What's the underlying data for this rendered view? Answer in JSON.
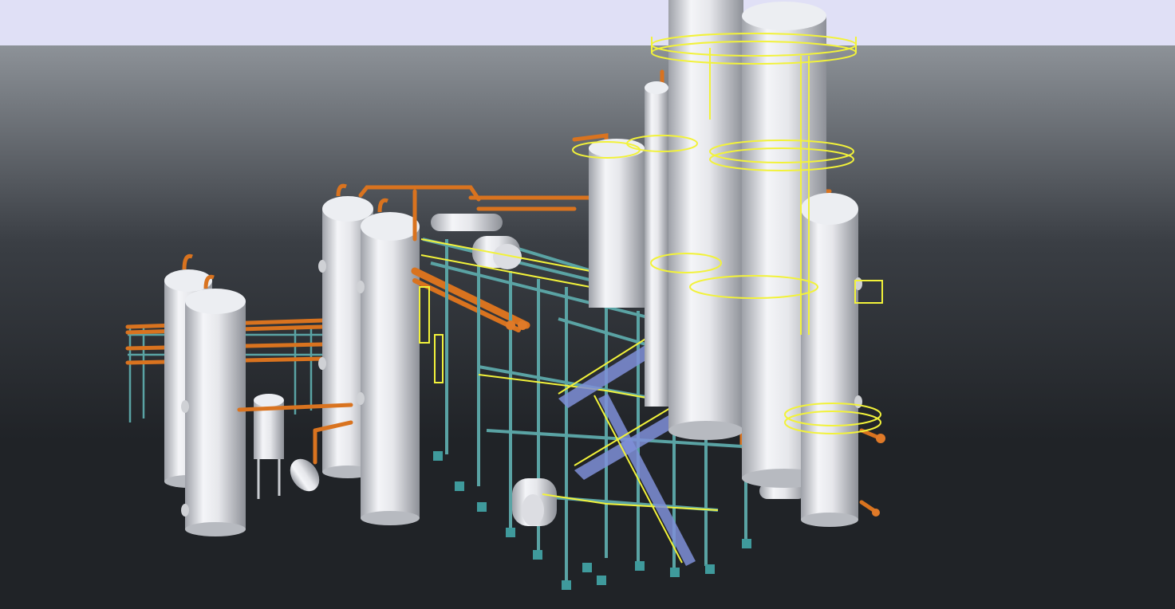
{
  "viewport": {
    "title": "",
    "colors": {
      "sky_band": "#e0e0f6",
      "ground_top": "#8d9298",
      "ground_mid": "#3a3e44",
      "ground_bottom": "#202327",
      "vessel_light": "#f2f3f6",
      "vessel_shadow": "#a9acb3",
      "pipe_orange": "#d9731f",
      "pipe_orange_light": "#f09a4a",
      "steel_teal": "#5aa3a4",
      "steel_teal_dark": "#3f7f80",
      "handrail_yellow": "#f2f23a",
      "stair_blue": "#7f8fd8"
    }
  },
  "scene_objects": [
    {
      "name": "column-left-1",
      "type": "vertical-vessel",
      "icon": "pressure-vessel-icon"
    },
    {
      "name": "column-left-2",
      "type": "vertical-vessel",
      "icon": "pressure-vessel-icon"
    },
    {
      "name": "small-drum",
      "type": "vertical-drum",
      "icon": "drum-icon"
    },
    {
      "name": "column-mid-1",
      "type": "vertical-vessel",
      "icon": "pressure-vessel-icon"
    },
    {
      "name": "column-mid-2",
      "type": "vertical-vessel",
      "icon": "pressure-vessel-icon"
    },
    {
      "name": "pipe-rack",
      "type": "steel-structure",
      "icon": "pipe-rack-icon"
    },
    {
      "name": "tall-tower-1",
      "type": "distillation-column",
      "icon": "tower-icon"
    },
    {
      "name": "tall-tower-2",
      "type": "distillation-column",
      "icon": "tower-icon"
    },
    {
      "name": "tower-right",
      "type": "vertical-vessel",
      "icon": "pressure-vessel-icon"
    },
    {
      "name": "stairway",
      "type": "stairs",
      "icon": "stairs-icon"
    }
  ]
}
